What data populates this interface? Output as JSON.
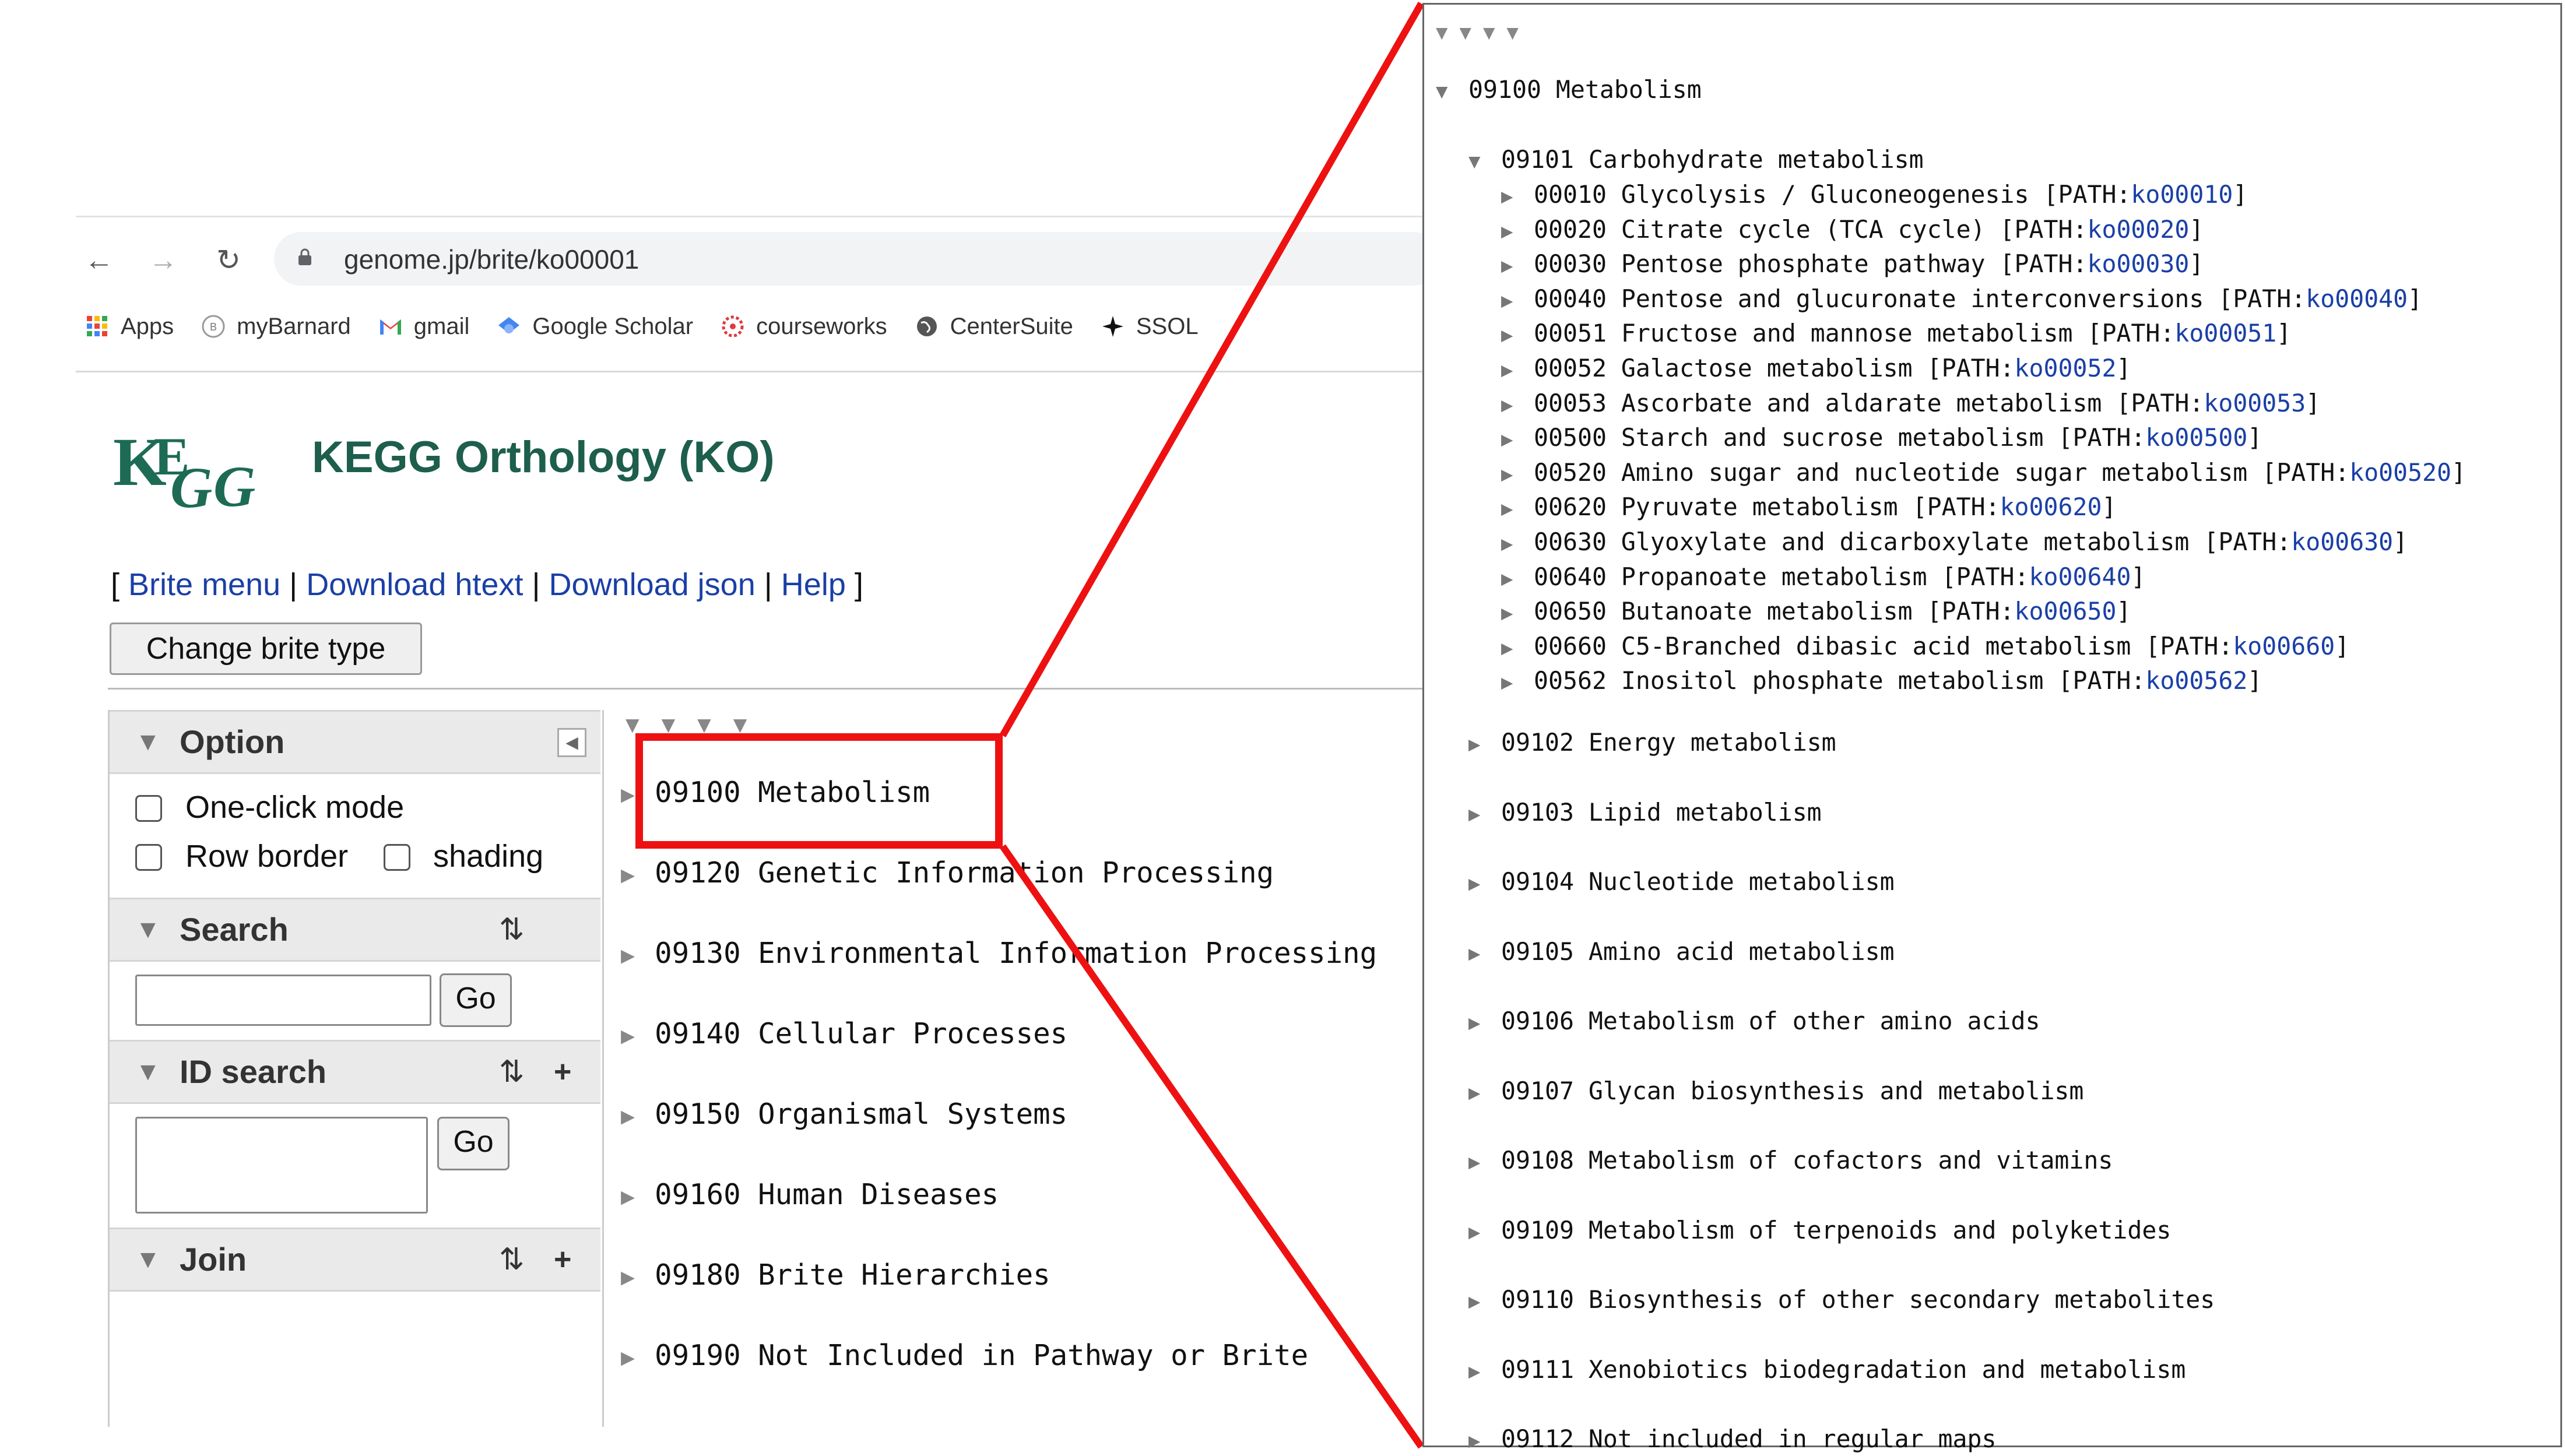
{
  "browser": {
    "url": "genome.jp/brite/ko00001",
    "bookmarks": [
      {
        "label": "Apps",
        "icon": "apps-grid-icon"
      },
      {
        "label": "myBarnard",
        "icon": "barnard-icon"
      },
      {
        "label": "gmail",
        "icon": "gmail-icon"
      },
      {
        "label": "Google Scholar",
        "icon": "scholar-icon"
      },
      {
        "label": "courseworks",
        "icon": "courseworks-icon"
      },
      {
        "label": "CenterSuite",
        "icon": "globe-icon"
      },
      {
        "label": "SSOL",
        "icon": "ssol-icon"
      }
    ]
  },
  "page": {
    "logo_text": "KEGG",
    "title": "KEGG Orthology (KO)",
    "links": {
      "bracket_open": "[",
      "brite_menu": "Brite menu",
      "sep": "|",
      "download_htext": "Download htext",
      "download_json": "Download json",
      "help": "Help",
      "bracket_close": "]"
    },
    "change_button": "Change brite type"
  },
  "sidebar": {
    "option": {
      "title": "Option",
      "one_click": "One-click mode",
      "row_border": "Row border",
      "shading": "shading"
    },
    "search": {
      "title": "Search",
      "go": "Go"
    },
    "id_search": {
      "title": "ID search",
      "go": "Go"
    },
    "join": {
      "title": "Join"
    }
  },
  "tree": {
    "items": [
      "09100 Metabolism",
      "09120 Genetic Information Processing",
      "09130 Environmental Information Processing",
      "09140 Cellular Processes",
      "09150 Organismal Systems",
      "09160 Human Diseases",
      "09180 Brite Hierarchies",
      "09190 Not Included in Pathway or Brite"
    ]
  },
  "zoom": {
    "root": "09100 Metabolism",
    "carbo": "09101 Carbohydrate metabolism",
    "pathways": [
      {
        "text": "00010 Glycolysis / Gluconeogenesis",
        "link": "ko00010"
      },
      {
        "text": "00020 Citrate cycle (TCA cycle)",
        "link": "ko00020"
      },
      {
        "text": "00030 Pentose phosphate pathway",
        "link": "ko00030"
      },
      {
        "text": "00040 Pentose and glucuronate interconversions",
        "link": "ko00040"
      },
      {
        "text": "00051 Fructose and mannose metabolism",
        "link": "ko00051"
      },
      {
        "text": "00052 Galactose metabolism",
        "link": "ko00052"
      },
      {
        "text": "00053 Ascorbate and aldarate metabolism",
        "link": "ko00053"
      },
      {
        "text": "00500 Starch and sucrose metabolism",
        "link": "ko00500"
      },
      {
        "text": "00520 Amino sugar and nucleotide sugar metabolism",
        "link": "ko00520"
      },
      {
        "text": "00620 Pyruvate metabolism",
        "link": "ko00620"
      },
      {
        "text": "00630 Glyoxylate and dicarboxylate metabolism",
        "link": "ko00630"
      },
      {
        "text": "00640 Propanoate metabolism",
        "link": "ko00640"
      },
      {
        "text": "00650 Butanoate metabolism",
        "link": "ko00650"
      },
      {
        "text": "00660 C5-Branched dibasic acid metabolism",
        "link": "ko00660"
      },
      {
        "text": "00562 Inositol phosphate metabolism",
        "link": "ko00562"
      }
    ],
    "subgroups": [
      "09102 Energy metabolism",
      "09103 Lipid metabolism",
      "09104 Nucleotide metabolism",
      "09105 Amino acid metabolism",
      "09106 Metabolism of other amino acids",
      "09107 Glycan biosynthesis and metabolism",
      "09108 Metabolism of cofactors and vitamins",
      "09109 Metabolism of terpenoids and polyketides",
      "09110 Biosynthesis of other secondary metabolites",
      "09111 Xenobiotics biodegradation and metabolism",
      "09112 Not included in regular maps"
    ]
  },
  "colors": {
    "link": "#1a3fa6",
    "title": "#1d5e4c",
    "highlight": "#ee1111"
  }
}
